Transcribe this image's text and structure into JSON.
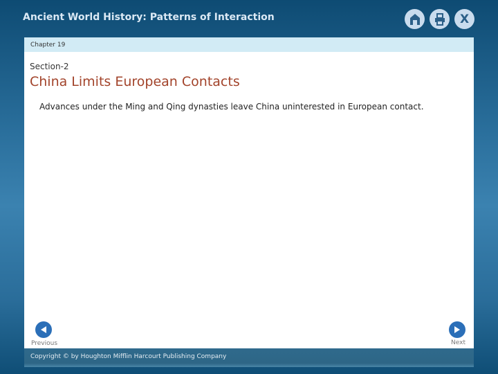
{
  "header": {
    "title": "Ancient World History: Patterns of Interaction",
    "icons": [
      "home-icon",
      "print-icon",
      "close-icon"
    ],
    "close_glyph": "X"
  },
  "chapter": "Chapter 19",
  "section": "Section-2",
  "heading": "China Limits European Contacts",
  "body": "Advances under the Ming and Qing dynasties leave China uninterested in European contact.",
  "nav": {
    "previous": "Previous",
    "next": "Next"
  },
  "footer": "Copyright © by Houghton Mifflin Harcourt Publishing Company"
}
